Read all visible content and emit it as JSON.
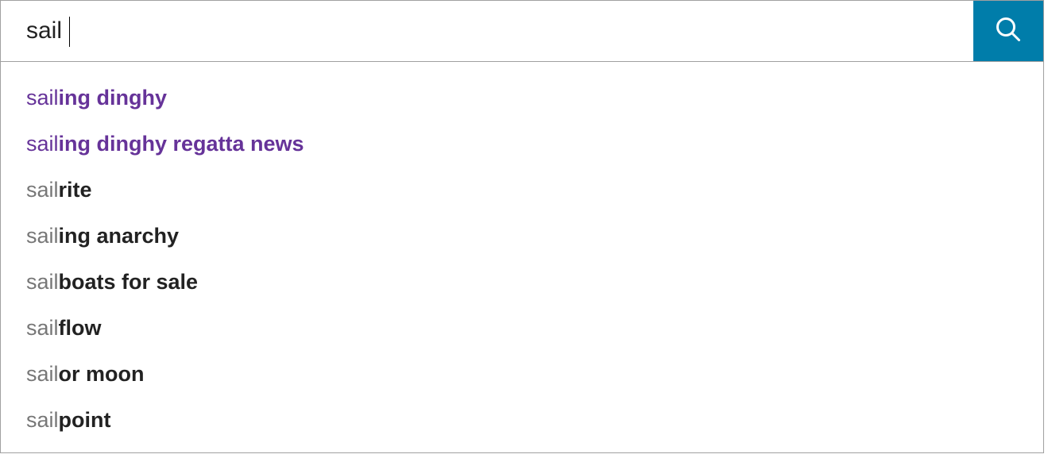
{
  "search": {
    "query": "sail",
    "button_color": "#007daa"
  },
  "suggestions": [
    {
      "prefix": "sail",
      "completion": "ing dinghy",
      "visited": true
    },
    {
      "prefix": "sail",
      "completion": "ing dinghy regatta news",
      "visited": true
    },
    {
      "prefix": "sail",
      "completion": "rite",
      "visited": false
    },
    {
      "prefix": "sail",
      "completion": "ing anarchy",
      "visited": false
    },
    {
      "prefix": "sail",
      "completion": "boats for sale",
      "visited": false
    },
    {
      "prefix": "sail",
      "completion": "flow",
      "visited": false
    },
    {
      "prefix": "sail",
      "completion": "or moon",
      "visited": false
    },
    {
      "prefix": "sail",
      "completion": "point",
      "visited": false
    }
  ]
}
